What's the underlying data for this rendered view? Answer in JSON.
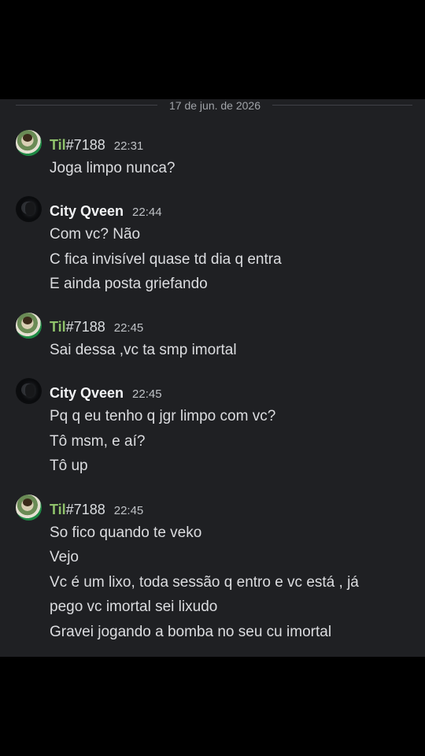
{
  "date_divider": "17 de jun. de 2026",
  "messages": [
    {
      "author": "Til",
      "tag": "#7188",
      "time": "22:31",
      "lines": [
        "Joga limpo nunca?"
      ]
    },
    {
      "author": "City Qveen",
      "tag": "",
      "time": "22:44",
      "lines": [
        "Com vc? Não",
        "C fica invisível quase td dia q entra",
        "E ainda posta griefando"
      ]
    },
    {
      "author": "Til",
      "tag": "#7188",
      "time": "22:45",
      "lines": [
        "Sai dessa ,vc ta smp imortal"
      ]
    },
    {
      "author": "City Qveen",
      "tag": "",
      "time": "22:45",
      "lines": [
        "Pq q eu tenho q jgr limpo com vc?",
        "Tô msm, e aí?",
        "Tô up"
      ]
    },
    {
      "author": "Til",
      "tag": "#7188",
      "time": "22:45",
      "lines": [
        "So fico quando te veko",
        "Vejo",
        "Vc é um lixo, toda sessão q entro  e vc está , já",
        "pego vc imortal sei lixudo",
        "Gravei jogando a bomba no seu cu imortal"
      ]
    }
  ],
  "colors": {
    "background": "#1f2023",
    "til_name": "#8fc26b",
    "city_name": "#f2f3f5",
    "text": "#dcdde0"
  }
}
